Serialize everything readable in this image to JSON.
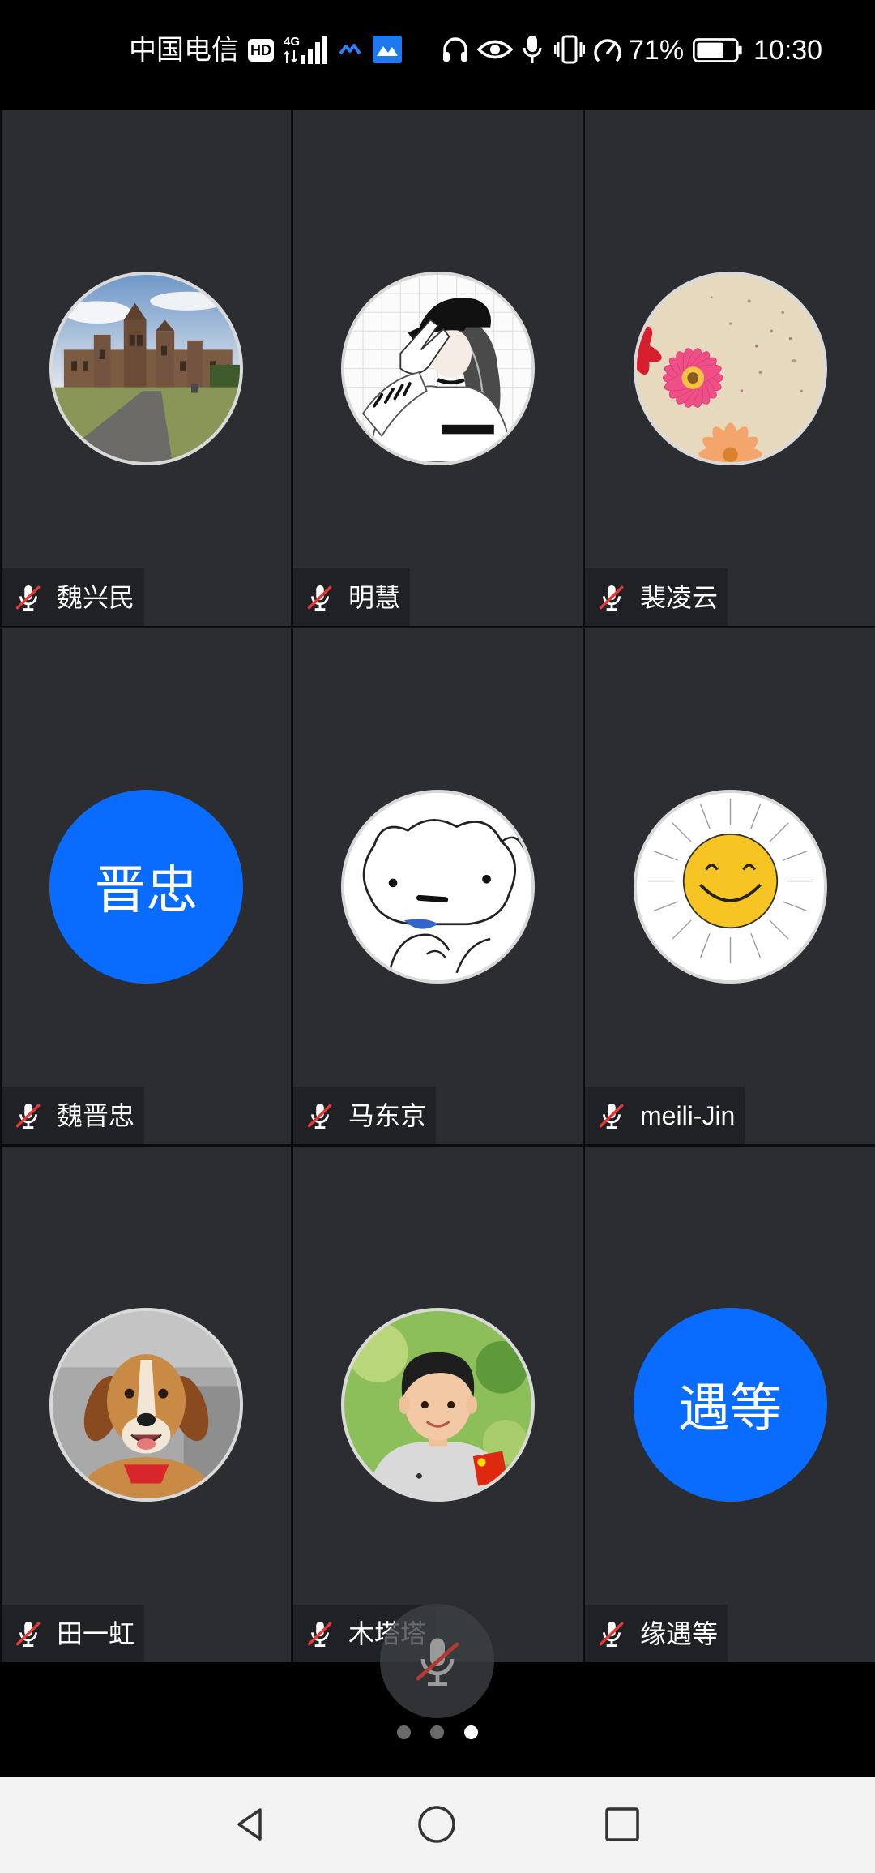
{
  "status_bar": {
    "carrier": "中国电信",
    "hd_badge": "HD",
    "network_type": "4G",
    "battery_percent": "71%",
    "time": "10:30"
  },
  "participants": [
    {
      "name": "魏兴民",
      "mic_muted": true,
      "avatar": "photo"
    },
    {
      "name": "明慧",
      "mic_muted": true,
      "avatar": "photo"
    },
    {
      "name": "裴凌云",
      "mic_muted": true,
      "avatar": "photo"
    },
    {
      "name": "魏晋忠",
      "mic_muted": true,
      "avatar": "initials",
      "initials": "晋忠"
    },
    {
      "name": "马东京",
      "mic_muted": true,
      "avatar": "photo"
    },
    {
      "name": "meili-Jin",
      "mic_muted": true,
      "avatar": "photo"
    },
    {
      "name": "田一虹",
      "mic_muted": true,
      "avatar": "photo"
    },
    {
      "name": "木塔塔",
      "mic_muted": true,
      "avatar": "photo"
    },
    {
      "name": "缘遇等",
      "mic_muted": true,
      "avatar": "initials",
      "initials": "遇等"
    }
  ],
  "controls": {
    "mic_muted": true
  },
  "pager": {
    "page_count": 3,
    "current_page": 3
  },
  "icons": {
    "status_bar": [
      "hd-icon",
      "signal-4g-icon",
      "app-icon",
      "app-icon",
      "headphones-icon",
      "eye-icon",
      "microphone-icon",
      "vibrate-icon",
      "speedometer-icon",
      "battery-icon"
    ],
    "tile_label": "mic-muted-icon",
    "control": "mic-muted-icon",
    "navigation": [
      "back-icon",
      "home-icon",
      "recents-icon"
    ]
  },
  "colors": {
    "tile_background": "#2b2d31",
    "label_background": "#1f2124",
    "initials_avatar": "#0a6cff",
    "muted_slash": "#e53935",
    "active_dot": "#ffffff",
    "inactive_dot": "#6b6b6b"
  }
}
